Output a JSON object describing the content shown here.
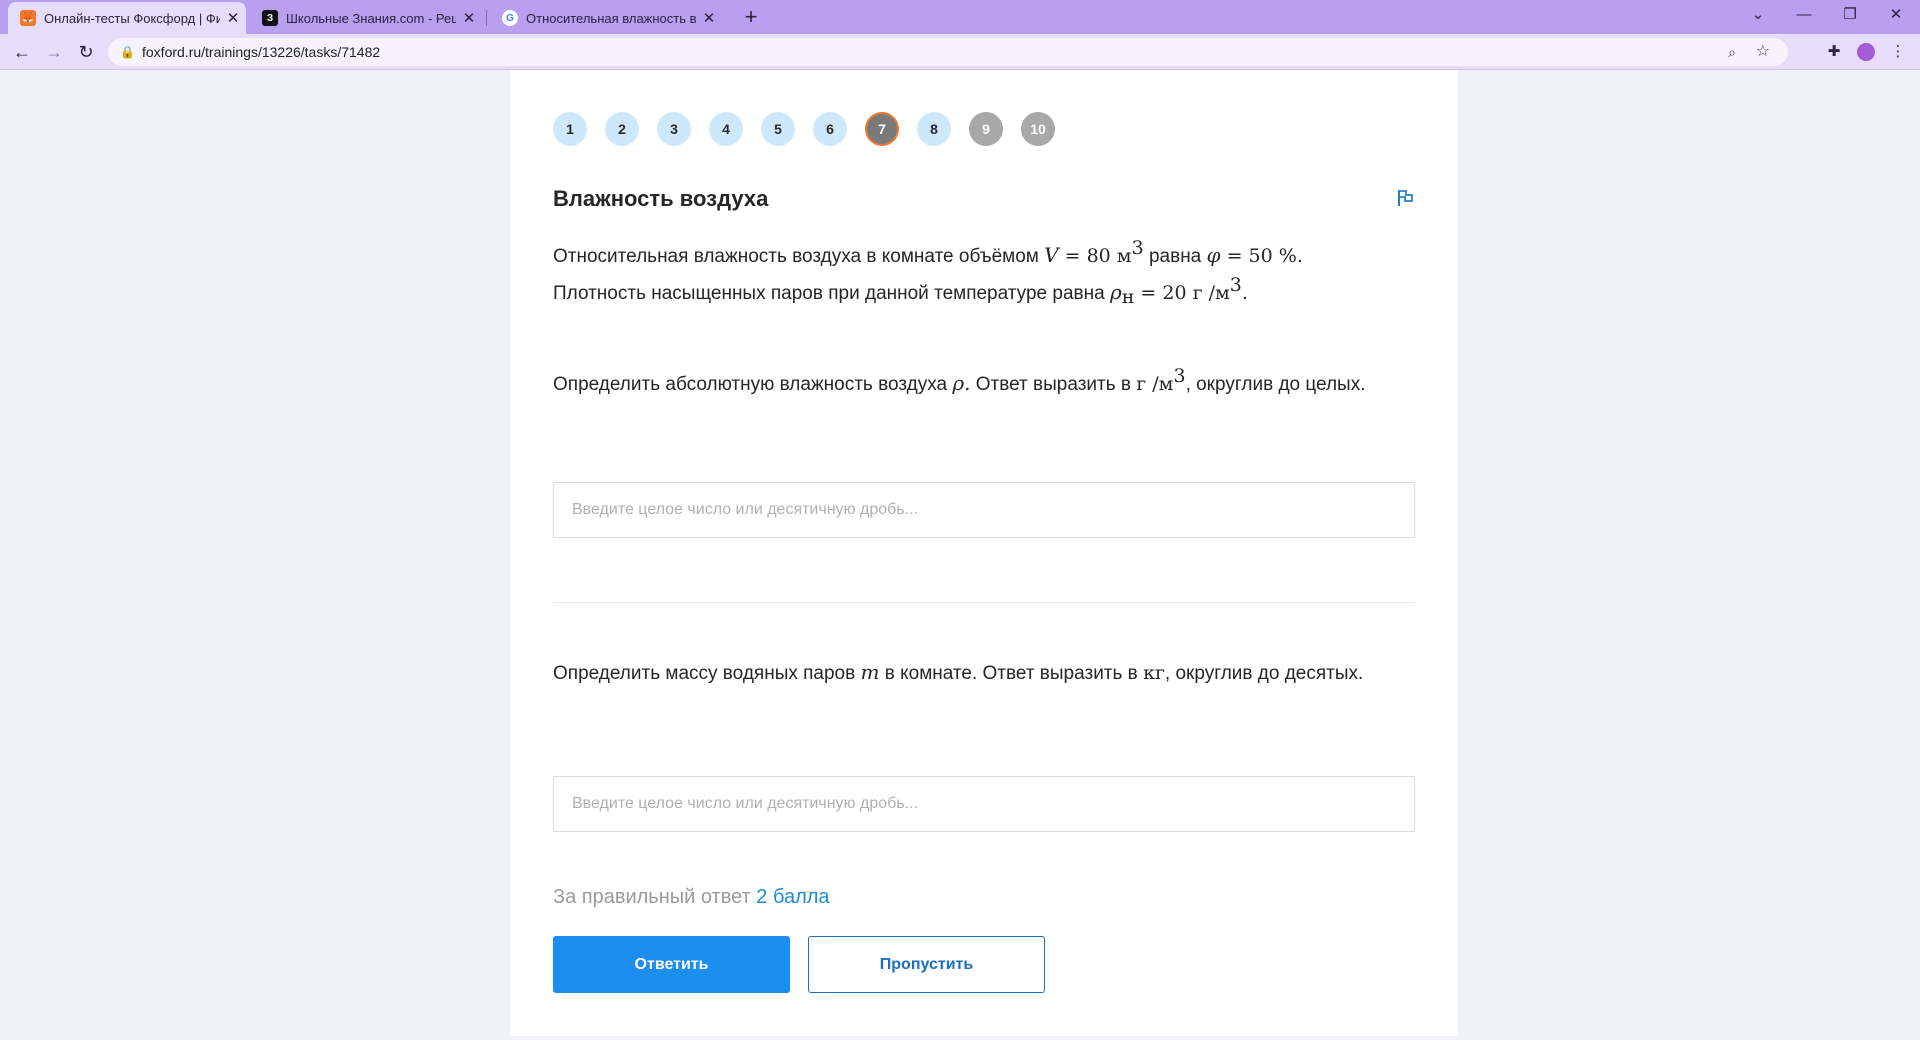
{
  "browser": {
    "tabs": [
      {
        "title": "Онлайн-тесты Фоксфорд | Физи",
        "active": true
      },
      {
        "title": "Школьные Знания.com - Решае",
        "active": false
      },
      {
        "title": "Относительная влажность возд",
        "active": false
      }
    ],
    "url": "foxford.ru/trainings/13226/tasks/71482"
  },
  "steps": [
    "1",
    "2",
    "3",
    "4",
    "5",
    "6",
    "7",
    "8",
    "9",
    "10"
  ],
  "current_step": "7",
  "task": {
    "title": "Влажность воздуха",
    "intro_1_a": "Относительная влажность воздуха  в комнате объёмом ",
    "intro_1_b": " равна ",
    "intro_2_a": "Плотность насыщенных паров при данной температуре равна ",
    "math_V": "V",
    "math_V_rest": " = 80 м",
    "math_phi": "φ",
    "math_phi_rest": " = 50 %.",
    "math_rho": "ρ",
    "math_rho_sub": "н",
    "math_rho_rest": " = 20 г /м",
    "math_cube": "3",
    "q1_a": "Определить абсолютную влажность воздуха ",
    "q1_var": "ρ.",
    "q1_b": " Ответ выразить в ",
    "q1_unit": "г /м",
    "q1_c": ", округлив до целых.",
    "q2_a": "Определить массу водяных паров ",
    "q2_var": "m",
    "q2_b": " в комнате. Ответ выразить в ",
    "q2_unit": "кг",
    "q2_c": ", округлив до десятых.",
    "input_placeholder": "Введите целое число или десятичную дробь..."
  },
  "footer": {
    "points_text": "За правильный ответ ",
    "points_value": "2 балла",
    "submit_label": "Ответить",
    "skip_label": "Пропустить"
  }
}
